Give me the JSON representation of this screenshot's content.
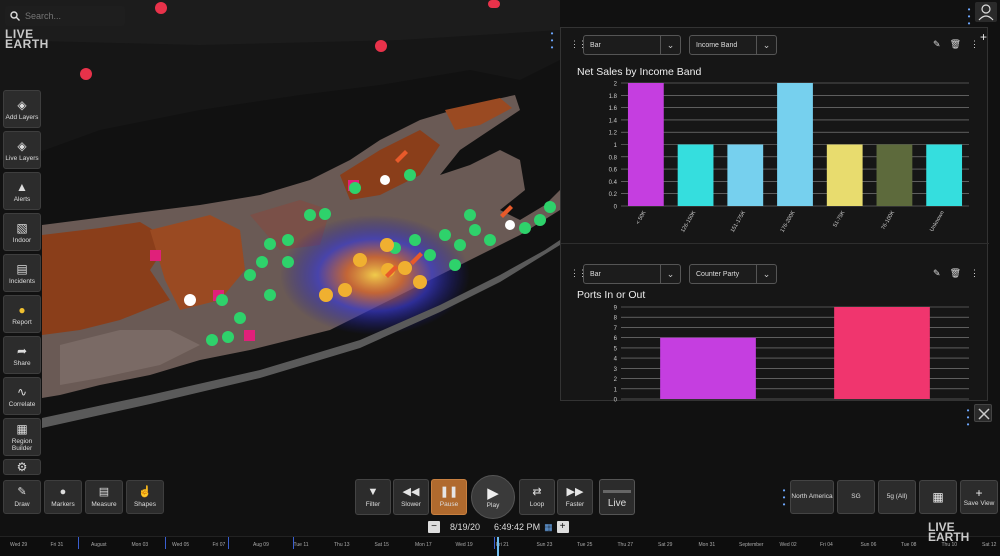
{
  "search": {
    "placeholder": "Search..."
  },
  "brand": {
    "line1": "LIVE",
    "line2": "EARTH"
  },
  "sidebar": [
    {
      "name": "add-layers",
      "icon": "layers-icon",
      "label": "Add Layers"
    },
    {
      "name": "live-layers",
      "icon": "layers-icon",
      "label": "Live Layers"
    },
    {
      "name": "alerts",
      "icon": "alert-icon",
      "label": "Alerts"
    },
    {
      "name": "indoor",
      "icon": "building-icon",
      "label": "Indoor"
    },
    {
      "name": "incidents",
      "icon": "clipboard-icon",
      "label": "Incidents"
    },
    {
      "name": "report",
      "icon": "bulb-icon",
      "label": "Report"
    },
    {
      "name": "share",
      "icon": "share-icon",
      "label": "Share"
    },
    {
      "name": "correlate",
      "icon": "correlate-icon",
      "label": "Correlate"
    },
    {
      "name": "region-builder",
      "icon": "region-icon",
      "label": "Region Builder"
    },
    {
      "name": "settings",
      "icon": "gear-icon",
      "label": ""
    }
  ],
  "widgets": {
    "w1": {
      "type_value": "Bar",
      "field_value": "Income Band",
      "title": "Net Sales by Income Band"
    },
    "w2": {
      "type_value": "Bar",
      "field_value": "Counter Party",
      "title": "Ports In or Out"
    }
  },
  "chart_data": [
    {
      "type": "bar",
      "title": "Net Sales by Income Band",
      "categories": [
        "< 50K",
        "126-150K",
        "151-175K",
        "176-200K",
        "51-75K",
        "76-100K",
        "Unknown"
      ],
      "values": [
        2,
        1,
        1,
        2,
        1,
        1,
        1
      ],
      "colors": [
        "#c53ee0",
        "#35dede",
        "#76d0ee",
        "#76d0ee",
        "#e8dc6e",
        "#5d6a3c",
        "#35dede"
      ],
      "ylim": [
        0,
        2
      ],
      "yticks": [
        "0",
        "0.2",
        "0.4",
        "0.6",
        "0.8",
        "1",
        "1.2",
        "1.4",
        "1.6",
        "1.8",
        "2"
      ],
      "grid": true
    },
    {
      "type": "bar",
      "title": "Ports In or Out",
      "categories": [
        "",
        ""
      ],
      "values": [
        6,
        9
      ],
      "colors": [
        "#c53ee0",
        "#f0356e"
      ],
      "ylim": [
        0,
        9
      ],
      "yticks": [
        "0",
        "1",
        "2",
        "3",
        "4",
        "5",
        "6",
        "7",
        "8",
        "9"
      ],
      "grid": true
    }
  ],
  "toolbar_left": [
    {
      "name": "draw",
      "icon": "pencil-icon",
      "label": "Draw"
    },
    {
      "name": "markers",
      "icon": "pin-icon",
      "label": "Markers"
    },
    {
      "name": "measure",
      "icon": "ruler-icon",
      "label": "Measure"
    },
    {
      "name": "shapes",
      "icon": "hand-icon",
      "label": "Shapes"
    }
  ],
  "playback": {
    "filter": "Filter",
    "slower": "Slower",
    "pause": "Pause",
    "play": "Play",
    "loop": "Loop",
    "faster": "Faster",
    "live": "Live"
  },
  "datetime": {
    "date": "8/19/20",
    "time": "6:49:42 PM"
  },
  "toolbar_right": [
    {
      "name": "north-america",
      "label": "North America"
    },
    {
      "name": "sg",
      "label": "SG"
    },
    {
      "name": "5g-all",
      "label": "5g (All)"
    }
  ],
  "save_view": "Save View",
  "timeline": [
    "Wed 29",
    "Fri 31",
    "August",
    "Mon 03",
    "Wed 05",
    "Fri 07",
    "Aug 09",
    "Tue 11",
    "Thu 13",
    "Sat 15",
    "Mon 17",
    "Wed 19",
    "Fri 21",
    "Sun 23",
    "Tue 25",
    "Thu 27",
    "Sat 29",
    "Mon 31",
    "September",
    "Wed 02",
    "Fri 04",
    "Sun 06",
    "Tue 08",
    "Thu 10",
    "Sat 12"
  ]
}
